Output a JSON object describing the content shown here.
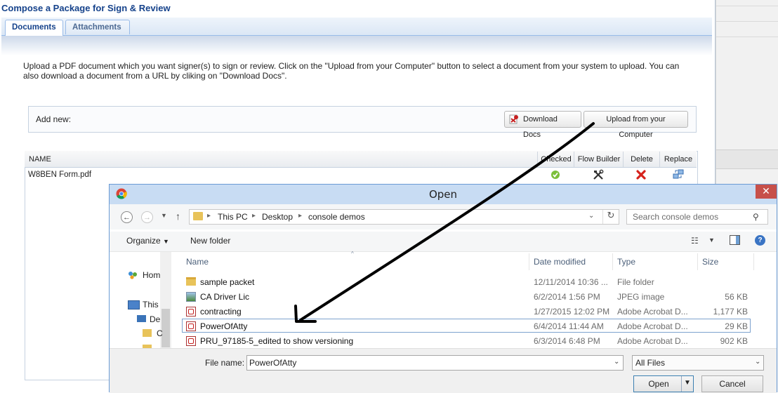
{
  "webapp": {
    "dialog_title": "Compose a Package for Sign & Review",
    "tabs": [
      {
        "label": "Documents",
        "active": true
      },
      {
        "label": "Attachments",
        "active": false
      }
    ],
    "intro_text": "Upload a PDF document which you want signer(s) to sign or review. Click on the \"Upload from your Computer\" button to select a document from your system to upload. You can also download a document from a URL by cliking on \"Download Docs\".",
    "add_new_label": "Add new:",
    "download_docs_label": "Download Docs",
    "upload_label": "Upload from your Computer",
    "grid": {
      "columns": [
        "NAME",
        "Checked",
        "Flow Builder",
        "Delete",
        "Replace"
      ],
      "rows": [
        {
          "name": "W8BEN Form.pdf",
          "checked_icon": "check-circle-icon",
          "flow_icon": "tools-icon",
          "delete_icon": "red-x-icon",
          "replace_icon": "replace-icon"
        }
      ]
    }
  },
  "file_dialog": {
    "title": "Open",
    "close_glyph": "✕",
    "breadcrumbs": [
      "This PC",
      "Desktop",
      "console demos"
    ],
    "search_placeholder": "Search console demos",
    "organize_label": "Organize",
    "new_folder_label": "New folder",
    "nav_items": [
      {
        "label": "Hom",
        "icon": "homegroup-icon"
      },
      {
        "label": "This",
        "icon": "computer-icon"
      },
      {
        "label": "De",
        "icon": "desktop-icon"
      },
      {
        "label": "C",
        "icon": "folder-icon"
      }
    ],
    "columns": [
      "Name",
      "Date modified",
      "Type",
      "Size"
    ],
    "files": [
      {
        "name": "sample packet",
        "date": "12/11/2014 10:36 ...",
        "type": "File folder",
        "size": "",
        "icon": "folder-icon"
      },
      {
        "name": "CA Driver Lic",
        "date": "6/2/2014 1:56 PM",
        "type": "JPEG image",
        "size": "56 KB",
        "icon": "image-icon"
      },
      {
        "name": "contracting",
        "date": "1/27/2015 12:02 PM",
        "type": "Adobe Acrobat D...",
        "size": "1,177 KB",
        "icon": "pdf-icon"
      },
      {
        "name": "PowerOfAtty",
        "date": "6/4/2014 11:44 AM",
        "type": "Adobe Acrobat D...",
        "size": "29 KB",
        "icon": "pdf-icon",
        "selected": true
      },
      {
        "name": "PRU_97185-5_edited to show versioning",
        "date": "6/3/2014 6:48 PM",
        "type": "Adobe Acrobat D...",
        "size": "902 KB",
        "icon": "pdf-icon"
      }
    ],
    "file_name_label": "File name:",
    "file_name_value": "PowerOfAtty",
    "file_type_value": "All Files",
    "open_label": "Open",
    "cancel_label": "Cancel"
  },
  "colors": {
    "title_blue": "#15428b",
    "dialog_titlebar": "#c8dcf3",
    "close_red": "#c7504a",
    "selection_border": "#7da2ce",
    "annotation_arrow": "#000000"
  }
}
